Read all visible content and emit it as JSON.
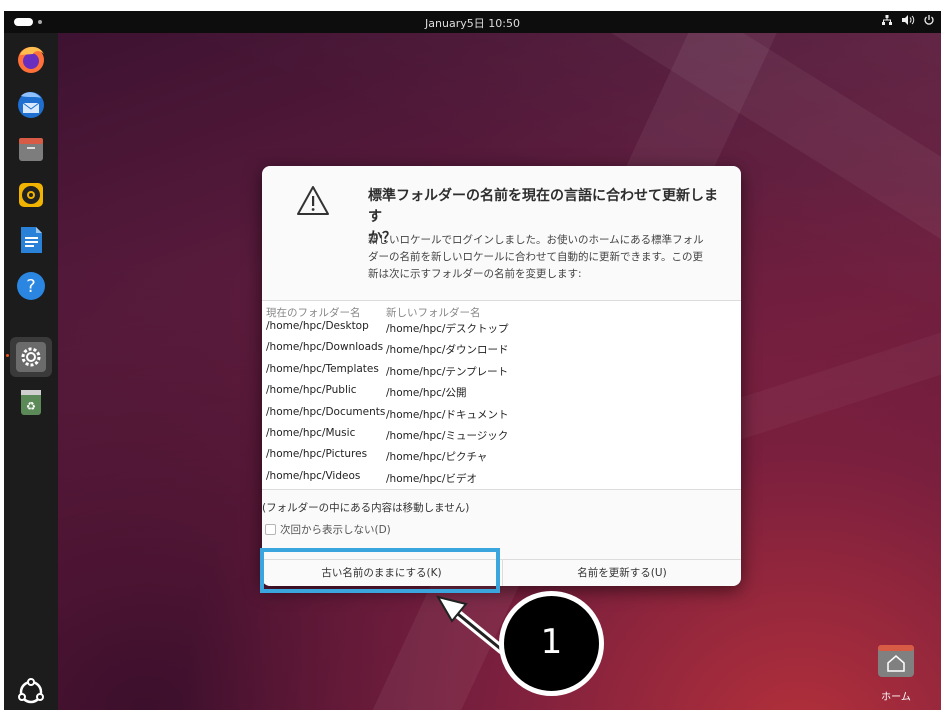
{
  "topbar": {
    "clock": "January5日 10:50",
    "tray_icons": [
      "network-icon",
      "volume-icon",
      "power-icon"
    ]
  },
  "dock": {
    "apps": [
      "firefox-icon",
      "thunderbird-icon",
      "files-icon",
      "rhythmbox-icon",
      "writer-icon",
      "help-icon",
      "settings-icon",
      "trash-icon"
    ],
    "bottom": "show-apps-icon"
  },
  "dialog": {
    "title": "標準フォルダーの名前を現在の言語に合わせて更新しますか？",
    "title_line1": "標準フォルダーの名前を現在の言語に合わせて更新します",
    "title_line2": "か？",
    "body_line1": "新しいロケールでログインしました。お使いのホームにある標準フォル",
    "body_line2": "ダーの名前を新しいロケールに合わせて自動的に更新できます。この更",
    "body_line3": "新は次に示すフォルダーの名前を変更します:",
    "col_current": "現在のフォルダー名",
    "col_new": "新しいフォルダー名",
    "rows": [
      {
        "current": "/home/hpc/Desktop",
        "new": "/home/hpc/デスクトップ"
      },
      {
        "current": "/home/hpc/Downloads",
        "new": "/home/hpc/ダウンロード"
      },
      {
        "current": "/home/hpc/Templates",
        "new": "/home/hpc/テンプレート"
      },
      {
        "current": "/home/hpc/Public",
        "new": "/home/hpc/公開"
      },
      {
        "current": "/home/hpc/Documents",
        "new": "/home/hpc/ドキュメント"
      },
      {
        "current": "/home/hpc/Music",
        "new": "/home/hpc/ミュージック"
      },
      {
        "current": "/home/hpc/Pictures",
        "new": "/home/hpc/ピクチャ"
      },
      {
        "current": "/home/hpc/Videos",
        "new": "/home/hpc/ビデオ"
      }
    ],
    "note": "(フォルダーの中にある内容は移動しません)",
    "checkbox_label": "次回から表示しない(D)",
    "checkbox_checked": false,
    "btn_keep": "古い名前のままにする(K)",
    "btn_update": "名前を更新する(U)"
  },
  "annotation": {
    "callout_number": "1",
    "highlight_color": "#3aa6dd"
  },
  "desktop": {
    "home_label": "ホーム"
  }
}
